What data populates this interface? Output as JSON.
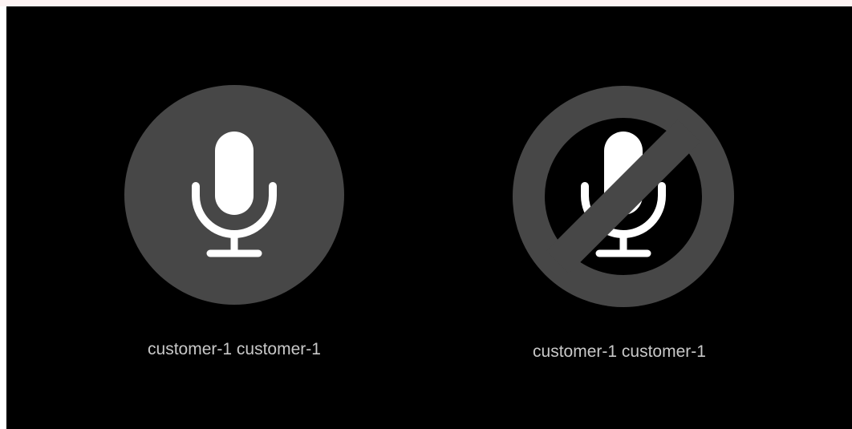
{
  "participants": [
    {
      "name": "customer-1 customer-1",
      "microphone": "on",
      "icon": "microphone-icon"
    },
    {
      "name": "customer-1 customer-1",
      "microphone": "muted",
      "icon": "microphone-muted-icon"
    }
  ],
  "colors": {
    "panel_background": "#000000",
    "avatar_circle": "#474747",
    "mic_glyph": "#ffffff",
    "label_text": "#c8c8c8"
  }
}
